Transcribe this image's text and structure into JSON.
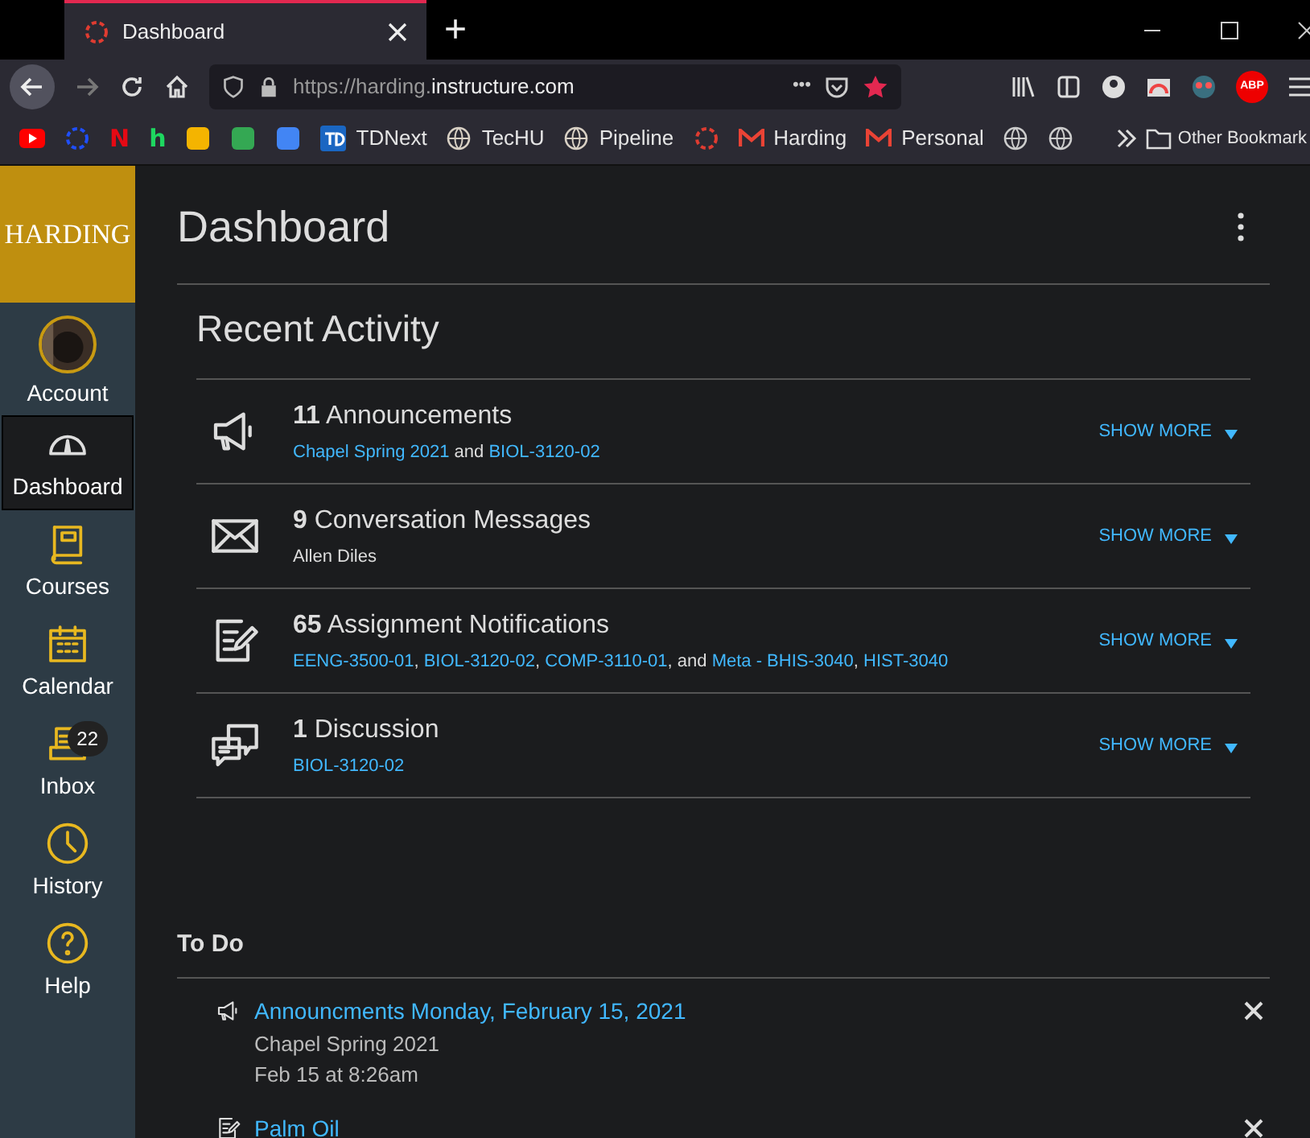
{
  "browser": {
    "tab": {
      "title": "Dashboard",
      "selected": true
    },
    "new_tab": "+",
    "address": {
      "prefix": "https://harding.",
      "domain": "instructure.com"
    },
    "more": "•••"
  },
  "bookmarks": [
    {
      "kind": "play",
      "color": "#ff0000"
    },
    {
      "kind": "ring",
      "color": "#1f4fff"
    },
    {
      "kind": "letter",
      "color": "#e50914",
      "label": "N"
    },
    {
      "kind": "letter",
      "color": "#1ed760",
      "label": "h"
    },
    {
      "kind": "square",
      "color": "#f4b400"
    },
    {
      "kind": "square",
      "color": "#34a853"
    },
    {
      "kind": "square",
      "color": "#4285f4"
    },
    {
      "kind": "td",
      "color": "#1a66c2",
      "text": "TDNext"
    },
    {
      "kind": "globe",
      "color": "#d8d0c4",
      "text": "TecHU"
    },
    {
      "kind": "globe",
      "color": "#d8d0c4",
      "text": "Pipeline"
    },
    {
      "kind": "ring",
      "color": "#e03c31"
    },
    {
      "kind": "mail",
      "color": "#ea4335",
      "text": "Harding"
    },
    {
      "kind": "mail",
      "color": "#ea4335",
      "text": "Personal"
    },
    {
      "kind": "globe",
      "color": "#cccccc"
    },
    {
      "kind": "globe",
      "color": "#cccccc"
    }
  ],
  "other_bookmarks": "Other Bookmark",
  "sidebar": {
    "logo": "HARDING",
    "items": [
      {
        "kind": "account",
        "label": "Account",
        "selected": false
      },
      {
        "kind": "dashboard",
        "label": "Dashboard",
        "selected": true
      },
      {
        "kind": "courses",
        "label": "Courses",
        "selected": false
      },
      {
        "kind": "calendar",
        "label": "Calendar",
        "selected": false
      },
      {
        "kind": "inbox",
        "label": "Inbox",
        "selected": false,
        "badge": "22"
      },
      {
        "kind": "history",
        "label": "History",
        "selected": false
      },
      {
        "kind": "help",
        "label": "Help",
        "selected": false
      }
    ]
  },
  "page_title": "Dashboard",
  "recent_activity": {
    "title": "Recent Activity",
    "items": [
      {
        "kind": "announcement",
        "count": "11",
        "title": "Announcements",
        "parts": [
          {
            "text": "Chapel Spring 2021",
            "link": true
          },
          {
            "text": " and ",
            "link": false
          },
          {
            "text": "BIOL-3120-02",
            "link": true
          }
        ],
        "action": "SHOW MORE"
      },
      {
        "kind": "message",
        "count": "9",
        "title": "Conversation Messages",
        "parts": [
          {
            "text": "Allen Diles",
            "link": false
          }
        ],
        "action": "SHOW MORE"
      },
      {
        "kind": "assignment",
        "count": "65",
        "title": "Assignment Notifications",
        "parts": [
          {
            "text": "EENG-3500-01",
            "link": true
          },
          {
            "text": ", ",
            "link": false
          },
          {
            "text": "BIOL-3120-02",
            "link": true
          },
          {
            "text": ", ",
            "link": false
          },
          {
            "text": "COMP-3110-01",
            "link": true
          },
          {
            "text": ", and ",
            "link": false
          },
          {
            "text": "Meta - BHIS-3040",
            "link": true
          },
          {
            "text": ", ",
            "link": false
          },
          {
            "text": "HIST-3040",
            "link": true
          }
        ],
        "action": "SHOW MORE"
      },
      {
        "kind": "discussion",
        "count": "1",
        "title": "Discussion",
        "parts": [
          {
            "text": "BIOL-3120-02",
            "link": true
          }
        ],
        "action": "SHOW MORE"
      }
    ]
  },
  "todo": {
    "title": "To Do",
    "items": [
      {
        "kind": "announcement",
        "title": "Announcments Monday, February 15, 2021",
        "lines": [
          "Chapel Spring 2021",
          "Feb 15 at 8:26am"
        ]
      },
      {
        "kind": "assignment",
        "title": "Palm Oil"
      }
    ]
  },
  "adblock": "ABP"
}
